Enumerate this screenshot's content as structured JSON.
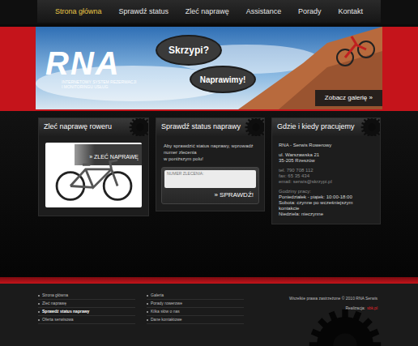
{
  "nav": [
    {
      "label": "Strona główna",
      "selected": true
    },
    {
      "label": "Sprawdź status",
      "selected": false
    },
    {
      "label": "Zleć naprawę",
      "selected": false
    },
    {
      "label": "Assistance",
      "selected": false
    },
    {
      "label": "Porady",
      "selected": false
    },
    {
      "label": "Kontakt",
      "selected": false
    }
  ],
  "banner": {
    "logo": "RNA",
    "tagline": [
      "INTERNETOWY SYSTEM REZERWACJI",
      "I MONITORINGU USŁUG"
    ],
    "bubbles": [
      "Skrzypi?",
      "Naprawimy!"
    ],
    "gallery_button": "Zobacz galerię »"
  },
  "order_panel": {
    "title": "Zleć naprawę roweru",
    "button": "» ZLEĆ NAPRAWĘ"
  },
  "status_panel": {
    "title": "Sprawdź status naprawy",
    "text": [
      "Aby sprawdzić status naprawy, wprowadź numer zlecenia",
      "w poniższym polu!"
    ],
    "input_placeholder": "NUMER ZLECENIA:",
    "button": "» SPRAWDŹ!"
  },
  "contact_panel": {
    "title": "Gdzie i kiedy pracujemy",
    "groups": [
      [
        "RNA - Serwis Rowerowy"
      ],
      [
        "ul. Warszawska 21",
        "35-205 Rzeszów"
      ],
      [
        "tel. 790 708 112",
        "fax: 65 35 434",
        "email: serwis@skrzypi.pl"
      ],
      [
        "Godziny pracy:",
        "Poniedziałek - piątek: 10:00-18:00",
        "Sobota: czynne po wcześniejszym kontakcie",
        "Niedziela: nieczynne"
      ]
    ]
  },
  "footer": {
    "columns": [
      [
        {
          "label": "Strona główna",
          "selected": false
        },
        {
          "label": "Zleć naprawę",
          "selected": false
        },
        {
          "label": "Sprawdź status naprawy",
          "selected": true
        },
        {
          "label": "Oferta serwisowa",
          "selected": false
        }
      ],
      [
        {
          "label": "Galeria",
          "selected": false
        },
        {
          "label": "Porady rowerowe",
          "selected": false
        },
        {
          "label": "Kilka słów o nas",
          "selected": false
        },
        {
          "label": "Dane kontaktowe",
          "selected": false
        }
      ]
    ],
    "copyright": "Wszelkie prawa zastrzeżone © 2010 RNA Serwis",
    "credit_label": "Realizacja:",
    "credit": "sbk.pl"
  }
}
